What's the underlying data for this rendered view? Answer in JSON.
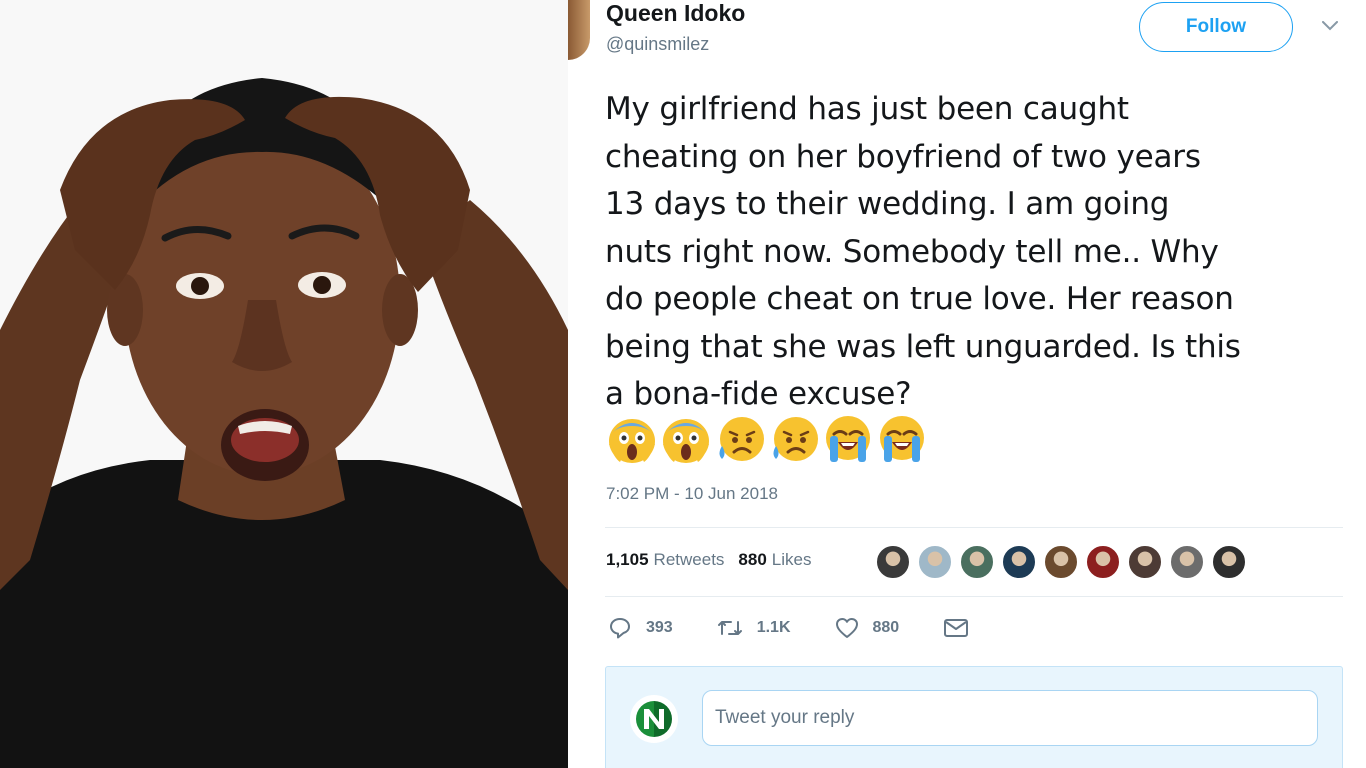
{
  "user": {
    "name": "Queen Idoko",
    "handle": "@quinsmilez",
    "follow_label": "Follow"
  },
  "tweet": {
    "text": "My girlfriend has just been caught\ncheating on her boyfriend of two years\n13 days to their wedding. I am going\nnuts right now. Somebody tell me.. Why\ndo people cheat on true love. Her reason\nbeing that she was left unguarded. Is this\na bona-fide excuse?",
    "emojis": [
      "face-screaming-in-fear",
      "face-screaming-in-fear",
      "disappointed-but-relieved-face",
      "disappointed-but-relieved-face",
      "loudly-crying-face",
      "loudly-crying-face"
    ],
    "timestamp": "7:02 PM - 10 Jun 2018"
  },
  "stats": {
    "retweets_count": "1,105",
    "retweets_label": "Retweets",
    "likes_count": "880",
    "likes_label": "Likes"
  },
  "likers": [
    "#3a3a3a",
    "#9fb8c8",
    "#4a6f5f",
    "#1d3b55",
    "#6b4a2e",
    "#8c1f1f",
    "#4d3b35",
    "#6c6c6c",
    "#2e2e2e"
  ],
  "actions": {
    "reply_count": "393",
    "retweet_count": "1.1K",
    "like_count": "880"
  },
  "reply": {
    "placeholder": "Tweet your reply"
  },
  "colors": {
    "accent": "#1da1f2",
    "text": "#14171a",
    "muted": "#657786"
  }
}
